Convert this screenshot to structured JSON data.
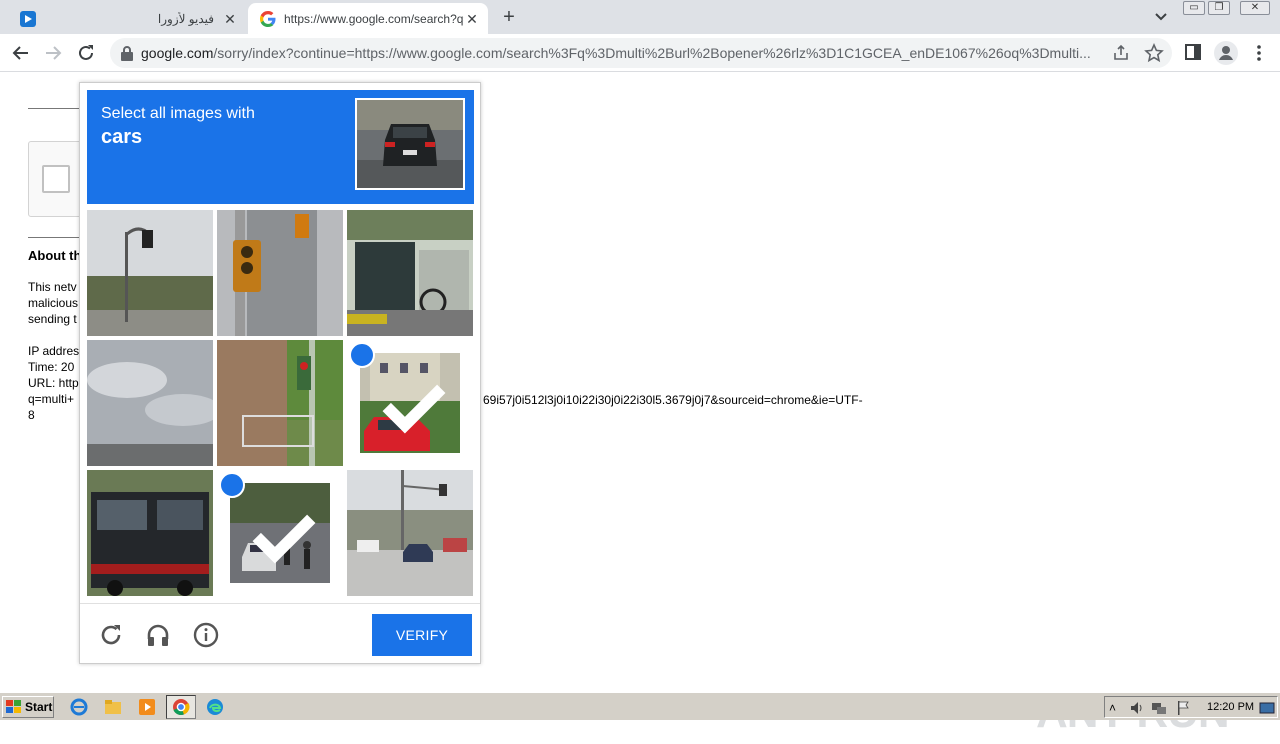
{
  "browser": {
    "tabs": [
      {
        "title": "فيديو لأزورا",
        "icon": "video-player-favicon"
      },
      {
        "title": "https://www.google.com/search?q=",
        "icon": "google-g-favicon"
      }
    ],
    "url_host": "google.com",
    "url_rest": "/sorry/index?continue=https://www.google.com/search%3Fq%3Dmulti%2Burl%2Bopener%26rlz%3D1C1GCEA_enDE1067%26oq%3Dmulti..."
  },
  "page": {
    "about_heading": "About th",
    "lines": [
      "This netv",
      "malicious",
      "sending t",
      "",
      "IP addres",
      "Time: 20",
      "URL: http",
      "q=multi+",
      "8"
    ],
    "url_tail": "69i57j0i512l3j0i10i22i30j0i22i30l5.3679j0j7&sourceid=chrome&ie=UTF-"
  },
  "captcha": {
    "instruction": "Select all images with",
    "target": "cars",
    "verify_label": "VERIFY",
    "tiles": [
      {
        "content": "street lamp and trees",
        "selected": false
      },
      {
        "content": "traffic light on pole",
        "selected": false
      },
      {
        "content": "storefront with bicycles",
        "selected": false
      },
      {
        "content": "cloudy sky over road",
        "selected": false
      },
      {
        "content": "pedestrian signal by fence",
        "selected": false
      },
      {
        "content": "red car by building",
        "selected": true
      },
      {
        "content": "truck",
        "selected": false
      },
      {
        "content": "road with car and motorbikes",
        "selected": true
      },
      {
        "content": "road junction with cars",
        "selected": false
      }
    ]
  },
  "watermark": "ANY RUN",
  "taskbar": {
    "start_label": "Start",
    "clock": "12:20 PM"
  },
  "colors": {
    "captcha_blue": "#1a73e8",
    "tabstrip": "#dee1e6",
    "taskbar": "#d4d0c8"
  }
}
